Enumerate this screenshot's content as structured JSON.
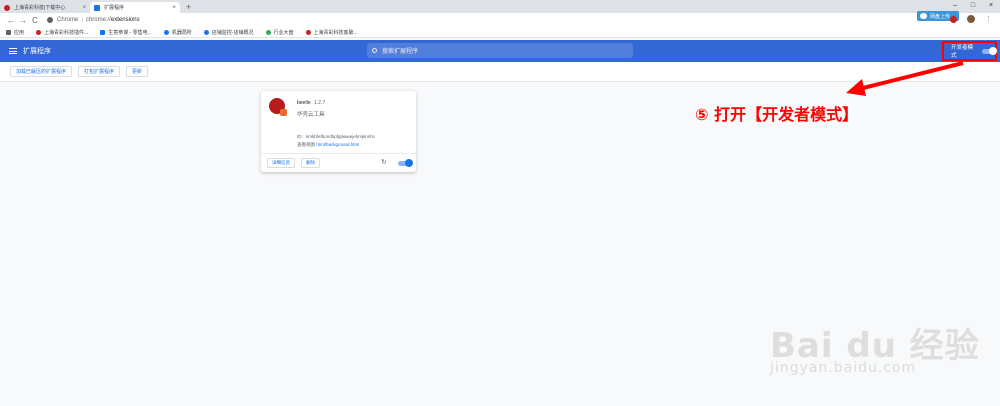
{
  "tabs": [
    {
      "title": "上海青彩科技|下载中心",
      "active": false
    },
    {
      "title": "扩展程序",
      "active": true
    }
  ],
  "window_controls": [
    "–",
    "□",
    "×"
  ],
  "toolbar": {
    "back": "←",
    "forward": "→",
    "reload": "C",
    "scheme_label": "Chrome",
    "separator": "|",
    "url_prefix": "chrome://",
    "url_path": "extensions",
    "cloud_button_label": "网盘上传",
    "menu_icon": "⋮"
  },
  "bookmarks": [
    {
      "label": "应用",
      "color": "#5f6368"
    },
    {
      "label": "上海青彩科技插件...",
      "color": "#c5221f"
    },
    {
      "label": "生意参谋 - 零售电...",
      "color": "#1a73e8"
    },
    {
      "label": "机器局所",
      "color": "#1a73e8"
    },
    {
      "label": "店铺监控-店铺概况",
      "color": "#1a73e8"
    },
    {
      "label": "行业大盘",
      "color": "#34a853"
    },
    {
      "label": "上海青彩科技客破...",
      "color": "#c5221f"
    }
  ],
  "header": {
    "title": "扩展程序",
    "search_placeholder": "搜索扩展程序",
    "dev_mode_label": "开发者模式"
  },
  "subbar": {
    "load_unpacked": "加载已解压的扩展程序",
    "pack": "打包扩展程序",
    "update": "更新"
  },
  "extension": {
    "name": "beetle",
    "version": "1.2.7",
    "description": "华壳云工具",
    "id_line": "ID：kmkbfefbondhpfglaawejebmjknnhc",
    "view_label": "查看视图",
    "view_link": "html/background.html",
    "details_button": "详细信息",
    "remove_button": "删除",
    "enabled": true
  },
  "annotation": "⑤ 打开【开发者模式】",
  "watermark": {
    "main": "Bai du 经验",
    "sub": "jingyan.baidu.com"
  }
}
